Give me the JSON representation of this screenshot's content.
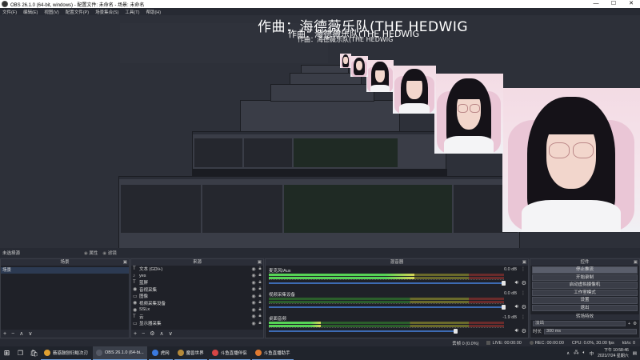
{
  "window": {
    "title": "OBS 26.1.0 (64-bit, windows) - 配置文件: 未命名 - 场景: 未命名",
    "minimize": "—",
    "maximize": "☐",
    "close": "✕"
  },
  "menu": [
    "文件(F)",
    "编辑(E)",
    "视图(V)",
    "配置文件(P)",
    "场景集合(S)",
    "工具(T)",
    "帮助(H)"
  ],
  "preview": {
    "lyric_main": "作曲：海德薇乐队(THE HEDWIG",
    "lyric_echo": "作曲：海德薇乐队(THE HEDWIG",
    "lyric_echo2": "作曲：海德薇乐队(THE HEDWIG"
  },
  "dock_strip": {
    "label": "未选择源",
    "toggle1": "属性",
    "toggle2": "滤镜"
  },
  "scenes": {
    "header": "场景",
    "items": [
      "场景"
    ],
    "footer": [
      "+",
      "−",
      "∧",
      "∨"
    ]
  },
  "sources": {
    "header": "来源",
    "items": [
      {
        "icon": "T",
        "name": "文本 (GDI+)"
      },
      {
        "icon": "♪",
        "name": "yes"
      },
      {
        "icon": "T",
        "name": "蓝屏"
      },
      {
        "icon": "◉",
        "name": "音视采集"
      },
      {
        "icon": "▭",
        "name": "图像"
      },
      {
        "icon": "◉",
        "name": "视频采集设备"
      },
      {
        "icon": "◉",
        "name": "SSLx"
      },
      {
        "icon": "T",
        "name": "云"
      },
      {
        "icon": "▭",
        "name": "显示器采集"
      }
    ],
    "footer": [
      "+",
      "−",
      "⚙",
      "∧",
      "∨"
    ]
  },
  "mixer": {
    "header": "混音器",
    "tracks": [
      {
        "name": "麦克风/Aux",
        "db": "0.0 dB",
        "level": 0.62
      },
      {
        "name": "视频采集设备",
        "db": "0.0 dB",
        "level": 0.0
      },
      {
        "name": "桌面音频",
        "db": "-1.9 dB",
        "level": 0.22
      }
    ]
  },
  "controls": {
    "header": "控件",
    "buttons": [
      "停止推流",
      "开始录制",
      "启动虚拟摄像机",
      "工作室模式",
      "设置",
      "退出"
    ],
    "transitions_header": "转场特效",
    "transition_value": "淡出",
    "duration_label": "时长",
    "duration_value": "300 ms"
  },
  "status": {
    "dropped": "丢帧 0 (0.0%)",
    "live": "LIVE: 00:00:00",
    "rec": "REC: 00:00:00",
    "cpu": "CPU: 0.0%, 30.00 fps",
    "kbps": "kb/s: 0"
  },
  "taskbar": {
    "apps": [
      {
        "name": "薮惑鼓刨归鲶次刃",
        "color": "#e0a030",
        "active": false
      },
      {
        "name": "OBS 26.1.0 (64-bi...",
        "color": "#555a66",
        "active": true
      },
      {
        "name": "虎网",
        "color": "#3a7ae0",
        "active": false
      },
      {
        "name": "魔兽世界",
        "color": "#b58a3a",
        "active": false
      },
      {
        "name": "斗鱼直播伴侣",
        "color": "#d64545",
        "active": false
      },
      {
        "name": "斗鱼直播助手",
        "color": "#e07a30",
        "active": false
      }
    ],
    "tray_text": "中",
    "time": "下午 10:58:46",
    "date": "2021/7/24 星期六"
  }
}
